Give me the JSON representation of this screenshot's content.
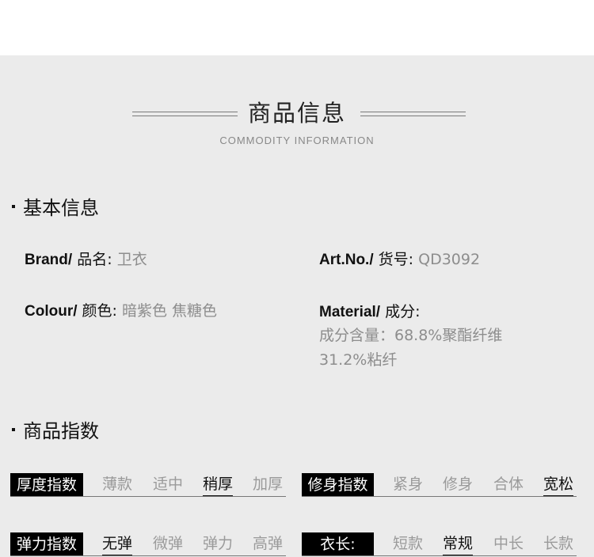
{
  "header": {
    "title": "商品信息",
    "subtitle": "COMMODITY INFORMATION"
  },
  "basic": {
    "heading": "基本信息",
    "brand_key": "Brand/",
    "brand_key_zh": "品名:",
    "brand_value": "卫衣",
    "art_key": "Art.No./",
    "art_key_zh": "货号:",
    "art_value": "QD3092",
    "colour_key": "Colour/",
    "colour_key_zh": "颜色:",
    "colour_value": "暗紫色 焦糖色",
    "material_key": "Material/",
    "material_key_zh": "成分:",
    "material_line1": "成分含量：68.8%聚酯纤维",
    "material_line2": "31.2%粘纤"
  },
  "index": {
    "heading": "商品指数",
    "thickness": {
      "label": "厚度指数",
      "options": [
        "薄款",
        "适中",
        "稍厚",
        "加厚"
      ],
      "selected": "稍厚"
    },
    "fit": {
      "label": "修身指数",
      "options": [
        "紧身",
        "修身",
        "合体",
        "宽松"
      ],
      "selected": "宽松"
    },
    "elasticity": {
      "label": "弹力指数",
      "options": [
        "无弹",
        "微弹",
        "弹力",
        "高弹"
      ],
      "selected": "无弹"
    },
    "length": {
      "label": "衣长:",
      "options": [
        "短款",
        "常规",
        "中长",
        "长款"
      ],
      "selected": "常规"
    }
  }
}
